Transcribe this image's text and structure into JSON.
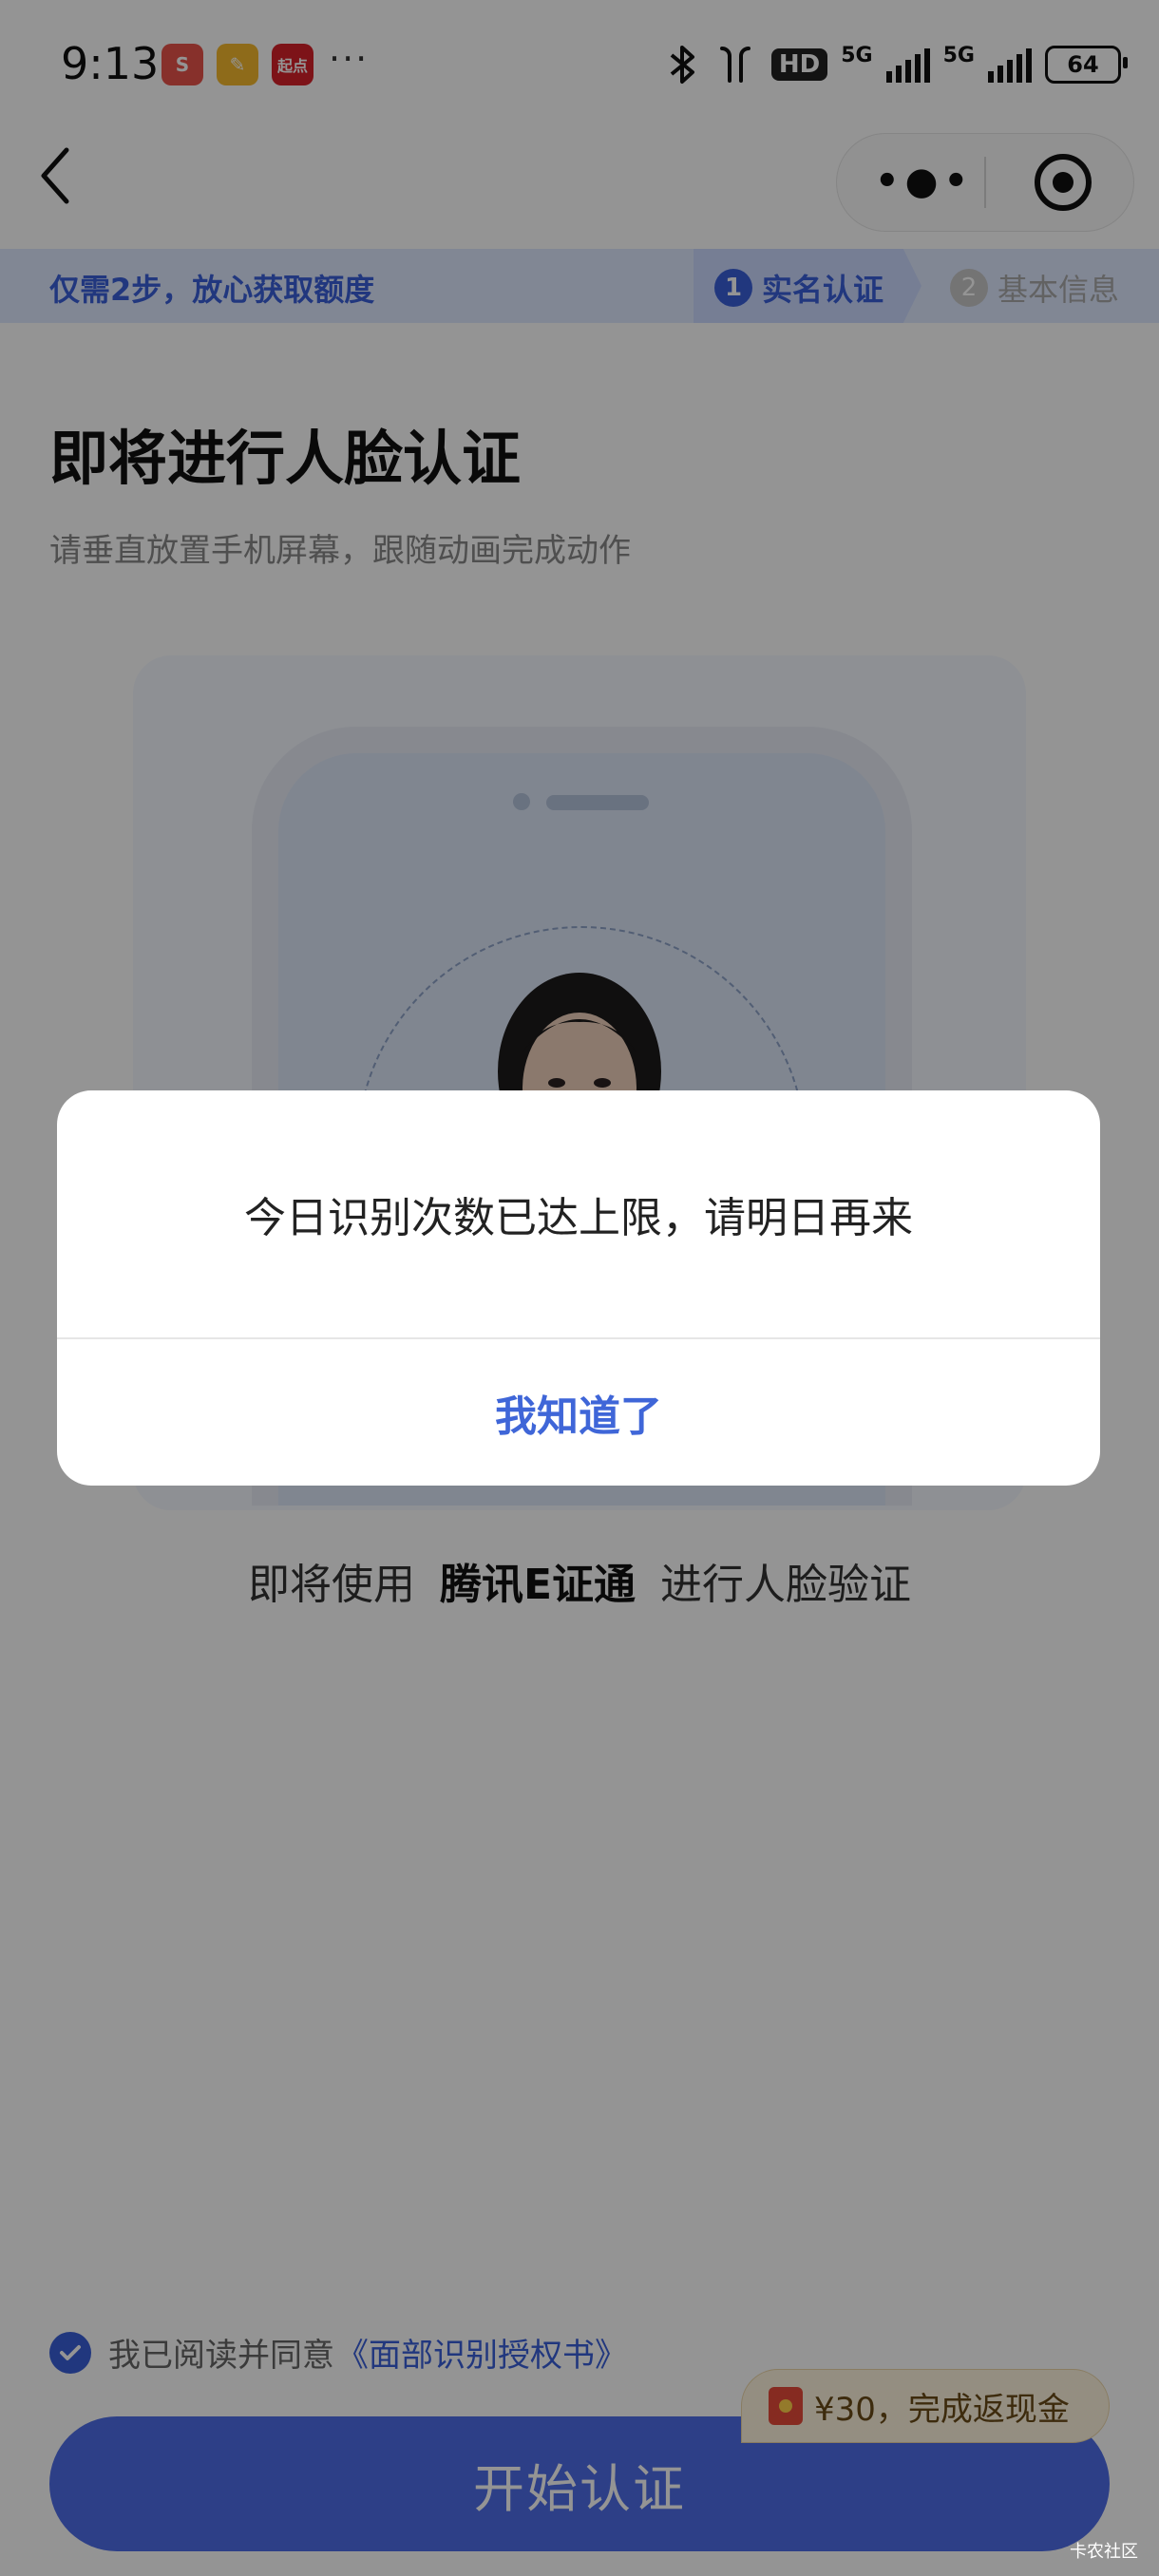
{
  "status_bar": {
    "time": "9:13",
    "app_icons": [
      {
        "name": "red-app-icon",
        "color": "#e9544a",
        "glyph": "S"
      },
      {
        "name": "notes-app-icon",
        "color": "#f5b92e",
        "glyph": "✎"
      },
      {
        "name": "qidian-app-icon",
        "color": "#d8222a",
        "glyph": "起点"
      }
    ],
    "more": "···",
    "hd_label": "HD",
    "network_1": "5G",
    "network_2": "5G",
    "battery": "64"
  },
  "nav": {
    "back_icon": "chevron-left-icon",
    "capsule_more_icon": "more-dots-icon",
    "capsule_close_icon": "target-icon"
  },
  "step_bar": {
    "title": "仅需2步，放心获取额度",
    "step1_num": "1",
    "step1_label": "实名认证",
    "step2_num": "2",
    "step2_label": "基本信息",
    "accent": "#3a5fd9"
  },
  "page": {
    "title": "即将进行人脸认证",
    "subtitle": "请垂直放置手机屏幕，跟随动画完成动作"
  },
  "provider": {
    "prefix": "即将使用",
    "name": "腾讯E证通",
    "suffix": "进行人脸验证"
  },
  "agreement": {
    "prefix": "我已阅读并同意",
    "link": "《面部识别授权书》",
    "checked": true
  },
  "start_button": "开始认证",
  "promo": {
    "text": "¥30，完成返现金"
  },
  "watermark": "卡农社区",
  "dialog": {
    "message": "今日识别次数已达上限，请明日再来",
    "button": "我知道了"
  }
}
